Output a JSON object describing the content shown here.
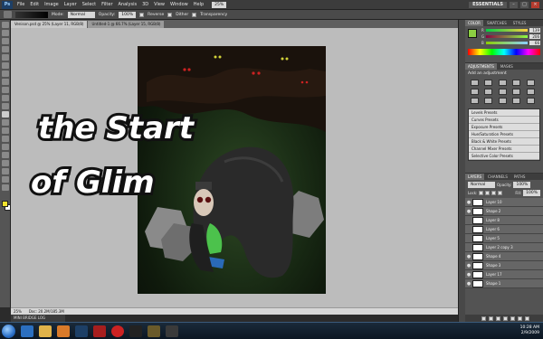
{
  "menu": {
    "logo": "Ps",
    "items": [
      "File",
      "Edit",
      "Image",
      "Layer",
      "Select",
      "Filter",
      "Analysis",
      "3D",
      "View",
      "Window",
      "Help"
    ],
    "zoom": "25%",
    "workspace": "ESSENTIALS"
  },
  "options": {
    "mode_label": "Mode:",
    "mode_value": "Normal",
    "opacity_label": "Opacity:",
    "opacity_value": "100%",
    "reverse_label": "Reverse",
    "dither_label": "Dither",
    "transparency_label": "Transparency"
  },
  "tabs": [
    {
      "label": "Venison.psd @ 25% (Layer 11, RGB/8)"
    },
    {
      "label": "Untitled-1 @ 66.7% (Layer 15, RGB/8)"
    }
  ],
  "canvas": {
    "title_line1": "the Start",
    "title_line2": "of Glim"
  },
  "status": {
    "zoom": "25%",
    "doc": "Doc: 20.2M/185.3M"
  },
  "minibridge": "MINI BRIDGE  LOG",
  "color_panel": {
    "tabs": [
      "COLOR",
      "SWATCHES",
      "STYLES"
    ],
    "r": "139",
    "g": "206",
    "b": "66"
  },
  "adjustments": {
    "tabs": [
      "ADJUSTMENTS",
      "MASKS"
    ],
    "title": "Add an adjustment",
    "presets": [
      "Levels Presets",
      "Curves Presets",
      "Exposure Presets",
      "Hue/Saturation Presets",
      "Black & White Presets",
      "Channel Mixer Presets",
      "Selective Color Presets"
    ]
  },
  "layers": {
    "tabs": [
      "LAYERS",
      "CHANNELS",
      "PATHS"
    ],
    "blend": "Normal",
    "opacity_label": "Opacity:",
    "opacity": "100%",
    "fill_label": "Fill:",
    "fill": "100%",
    "lock_label": "Lock:",
    "items": [
      {
        "name": "Layer 10"
      },
      {
        "name": "Shape 2"
      },
      {
        "name": "Layer 8"
      },
      {
        "name": "Layer 6"
      },
      {
        "name": "Layer 5"
      },
      {
        "name": "Layer 2 copy 3"
      },
      {
        "name": "Shape 4"
      },
      {
        "name": "Shape 3"
      },
      {
        "name": "Layer 17"
      },
      {
        "name": "Shape 1"
      }
    ]
  },
  "taskbar": {
    "time": "10:28 AM",
    "date": "2/9/2009"
  }
}
